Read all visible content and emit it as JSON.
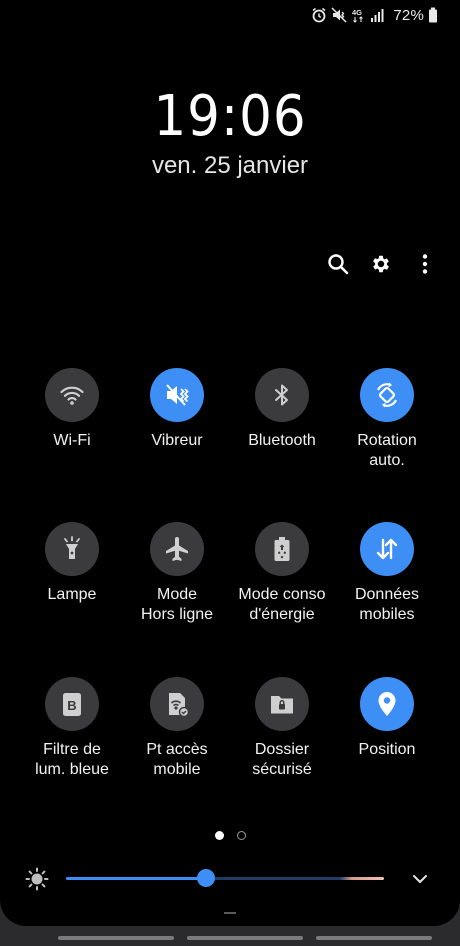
{
  "status_bar": {
    "battery_percent": "72%",
    "icons": [
      "alarm-icon",
      "vibrate-icon",
      "4g-icon",
      "signal-icon",
      "battery-icon"
    ],
    "network_label": "4G"
  },
  "clock": {
    "time": "19:06",
    "date": "ven. 25 janvier"
  },
  "top_actions": [
    "search-icon",
    "gear-icon",
    "more-vert-icon"
  ],
  "tiles": [
    {
      "label": "Wi-Fi",
      "icon": "wifi-icon",
      "on": false
    },
    {
      "label": "Vibreur",
      "icon": "vibrate-icon",
      "on": true
    },
    {
      "label": "Bluetooth",
      "icon": "bluetooth-icon",
      "on": false
    },
    {
      "label": "Rotation\nauto.",
      "icon": "rotation-icon",
      "on": true
    },
    {
      "label": "Lampe",
      "icon": "flashlight-icon",
      "on": false
    },
    {
      "label": "Mode\nHors ligne",
      "icon": "airplane-icon",
      "on": false
    },
    {
      "label": "Mode conso\nd'énergie",
      "icon": "power-saving-icon",
      "on": false
    },
    {
      "label": "Données\nmobiles",
      "icon": "mobile-data-icon",
      "on": true
    },
    {
      "label": "Filtre de\nlum. bleue",
      "icon": "blue-light-filter-icon",
      "on": false
    },
    {
      "label": "Pt accès\nmobile",
      "icon": "hotspot-icon",
      "on": false
    },
    {
      "label": "Dossier\nsécurisé",
      "icon": "secure-folder-icon",
      "on": false
    },
    {
      "label": "Position",
      "icon": "location-icon",
      "on": true
    }
  ],
  "page_indicator": {
    "current": 1,
    "total": 2
  },
  "brightness": {
    "level": 0.44
  },
  "colors": {
    "accent": "#3d8ef5",
    "tile_off": "#3b3b3d",
    "background": "#000000"
  }
}
